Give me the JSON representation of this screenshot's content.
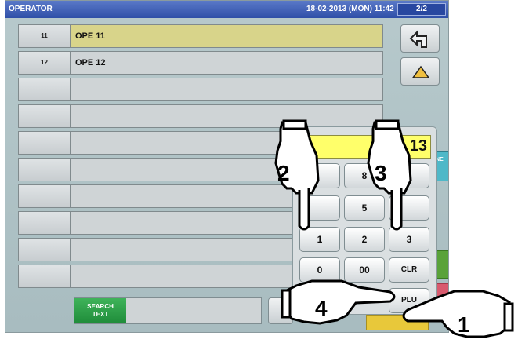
{
  "titlebar": {
    "title": "OPERATOR",
    "datetime": "18-02-2013 (MON) 11:42",
    "page": "2/2"
  },
  "rows": [
    {
      "no": "11",
      "name": "OPE 11",
      "selected": true
    },
    {
      "no": "12",
      "name": "OPE 12",
      "selected": false
    },
    {
      "no": "",
      "name": ""
    },
    {
      "no": "",
      "name": ""
    },
    {
      "no": "",
      "name": ""
    },
    {
      "no": "",
      "name": ""
    },
    {
      "no": "",
      "name": ""
    },
    {
      "no": "",
      "name": ""
    },
    {
      "no": "",
      "name": ""
    },
    {
      "no": "",
      "name": ""
    }
  ],
  "keypad": {
    "display": "13",
    "keys": [
      "8",
      "5",
      "1",
      "2",
      "3",
      "0",
      "00",
      "CLR",
      "PLU"
    ]
  },
  "search": {
    "label_line1": "SEARCH",
    "label_line2": "TEXT"
  },
  "side": {
    "back_icon": "return-arrow-icon",
    "up_icon": "up-triangle-icon",
    "tab_label": "NE"
  },
  "hands": [
    "1",
    "2",
    "3",
    "4"
  ],
  "colors": {
    "titlebar": "#2f4fa8",
    "selected_row": "#d8d48a",
    "display": "#ffff6a",
    "search_btn": "#1f8c3a"
  }
}
